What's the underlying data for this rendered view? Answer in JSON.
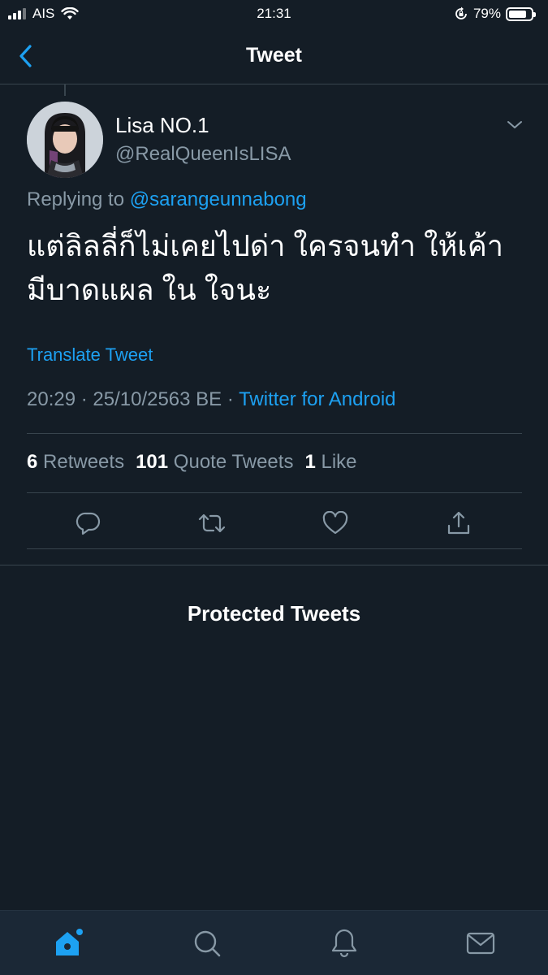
{
  "status_bar": {
    "carrier": "AIS",
    "time": "21:31",
    "battery_percent": "79%",
    "battery_level": 0.79
  },
  "nav": {
    "title": "Tweet",
    "back_icon": "chevron-left-icon"
  },
  "tweet": {
    "display_name": "Lisa NO.1",
    "handle": "@RealQueenIsLISA",
    "replying_to_prefix": "Replying to",
    "replying_to_mention": "@sarangeunnabong",
    "text_line1": "แต่ลิลลี่ก็ไม่เคยไปด่า ใครจนทำ ให้เค้า",
    "text_line2": "มีบาดแผล ใน ใจนะ",
    "translate_label": "Translate Tweet",
    "timestamp": "20:29 · 25/10/2563 BE ·",
    "source": "Twitter for Android"
  },
  "stats": {
    "retweets_count": "6",
    "retweets_label": "Retweets",
    "quotes_count": "101",
    "quotes_label": "Quote Tweets",
    "likes_count": "1",
    "likes_label": "Like"
  },
  "actions": [
    "reply-icon",
    "retweet-icon",
    "like-icon",
    "share-icon"
  ],
  "protected_label": "Protected Tweets",
  "tab_bar": [
    "home-icon",
    "search-icon",
    "notifications-icon",
    "messages-icon"
  ],
  "colors": {
    "background": "#141d26",
    "accent": "#1da1f2",
    "muted": "#8899a6",
    "divider": "#38444d",
    "tab_bar": "#1b2836"
  }
}
